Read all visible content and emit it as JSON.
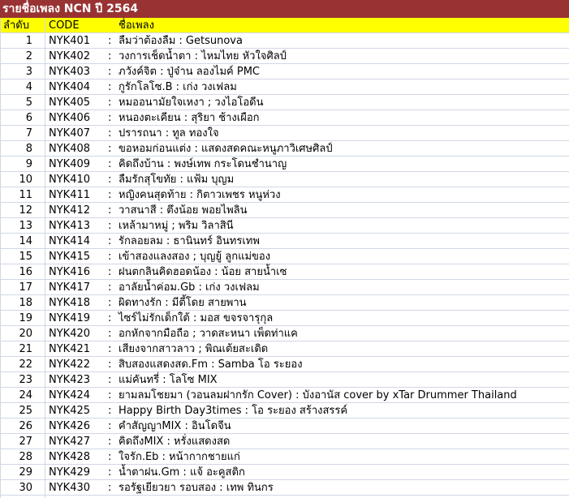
{
  "title": "รายชื่อเพลง NCN ปี 2564",
  "header": {
    "no": "ลำดับ",
    "code": "CODE",
    "name": "ชื่อเพลง"
  },
  "separator": ":",
  "rows": [
    {
      "no": "1",
      "code": "NYK401",
      "name": "ลืมว่าต้องลืม : Getsunova"
    },
    {
      "no": "2",
      "code": "NYK402",
      "name": "วงการเช็ดน้ำตา : ไหมไทย หัวใจศิลป์"
    },
    {
      "no": "3",
      "code": "NYK403",
      "name": "ภวังค์จิต : ปู่จ๋าน ลองไมค์ PMC"
    },
    {
      "no": "4",
      "code": "NYK404",
      "name": "กูรักโลโซ.B : เก่ง วงเฟลม"
    },
    {
      "no": "5",
      "code": "NYK405",
      "name": "หมออนามัยใจเหงา     ;    วงไอโอดีน"
    },
    {
      "no": "6",
      "code": "NYK406",
      "name": "หนองตะเคียน : สุริยา ช้างเผือก"
    },
    {
      "no": "7",
      "code": "NYK407",
      "name": "ปรารถนา : ทูล ทองใจ"
    },
    {
      "no": "8",
      "code": "NYK408",
      "name": "ขอหอมก่อนแต่ง : แสดงสดคณะหนูภาวิเศษศิลป์"
    },
    {
      "no": "9",
      "code": "NYK409",
      "name": "คิดถึงบ้าน : พงษ์เทพ กระโดนชำนาญ"
    },
    {
      "no": "10",
      "code": "NYK410",
      "name": "ลืมรักสุโขทัย : แฟ้ม บุญม"
    },
    {
      "no": "11",
      "code": "NYK411",
      "name": "หญิงคนสุดท้าย : กิตาวเพชร หนูห่วง"
    },
    {
      "no": "12",
      "code": "NYK412",
      "name": "วาสนาสี : ตึงน้อย พอยไพลิน"
    },
    {
      "no": "13",
      "code": "NYK413",
      "name": "เหล้ามาหมู่     ;    พริม วิลาสินี"
    },
    {
      "no": "14",
      "code": "NYK414",
      "name": "รักลอยลม : ธานินทร์ อินทรเทพ"
    },
    {
      "no": "15",
      "code": "NYK415",
      "name": "เข้าสองแลงสอง     ;    บุญยู้ ลูกแม่ของ"
    },
    {
      "no": "16",
      "code": "NYK416",
      "name": "ฝนตกลินคิดฮอดน้อง : น้อย สายน้ำเซ"
    },
    {
      "no": "17",
      "code": "NYK417",
      "name": "อาลัยน้ำค่อม.Gb : เก่ง วงเฟลม"
    },
    {
      "no": "18",
      "code": "NYK418",
      "name": "ผิดทางรัก : มีตี้โดย สายพาน"
    },
    {
      "no": "19",
      "code": "NYK419",
      "name": "ไซร์ไม่รักเด็กใต้ : มอส ขจรจารุกุล"
    },
    {
      "no": "20",
      "code": "NYK420",
      "name": "อกหักจากมือถือ     ;    วาดสะหนา เพ็ดท่าแค"
    },
    {
      "no": "21",
      "code": "NYK421",
      "name": "เสียงจากสาวลาว     ;    พิณเต้ยสะเดิด"
    },
    {
      "no": "22",
      "code": "NYK422",
      "name": "สิบสองแสดงสด.Fm : Samba โอ ระยอง"
    },
    {
      "no": "23",
      "code": "NYK423",
      "name": "แม่คันทรี่ : โลโซ MIX"
    },
    {
      "no": "24",
      "code": "NYK424",
      "name": "ยามลมโชยมา (วอนลมฝากรัก Cover) : บังอานัส cover by xTar Drummer Thailand"
    },
    {
      "no": "25",
      "code": "NYK425",
      "name": "Happy Birth Day3times : โอ ระยอง สร้างสรรค์"
    },
    {
      "no": "26",
      "code": "NYK426",
      "name": "คำสัญญาMIX : อินโดจีน"
    },
    {
      "no": "27",
      "code": "NYK427",
      "name": "คิดถึงMIX : หรั่งแสดงสด"
    },
    {
      "no": "28",
      "code": "NYK428",
      "name": "ใจรัก.Eb     :    หน้ากากชายแก่"
    },
    {
      "no": "29",
      "code": "NYK429",
      "name": "น้ำตาฝน.Gm : แจ้ อะคูสติก"
    },
    {
      "no": "30",
      "code": "NYK430",
      "name": "รอรัฐเยียวยา รอบสอง : เทพ ทินกร"
    }
  ]
}
